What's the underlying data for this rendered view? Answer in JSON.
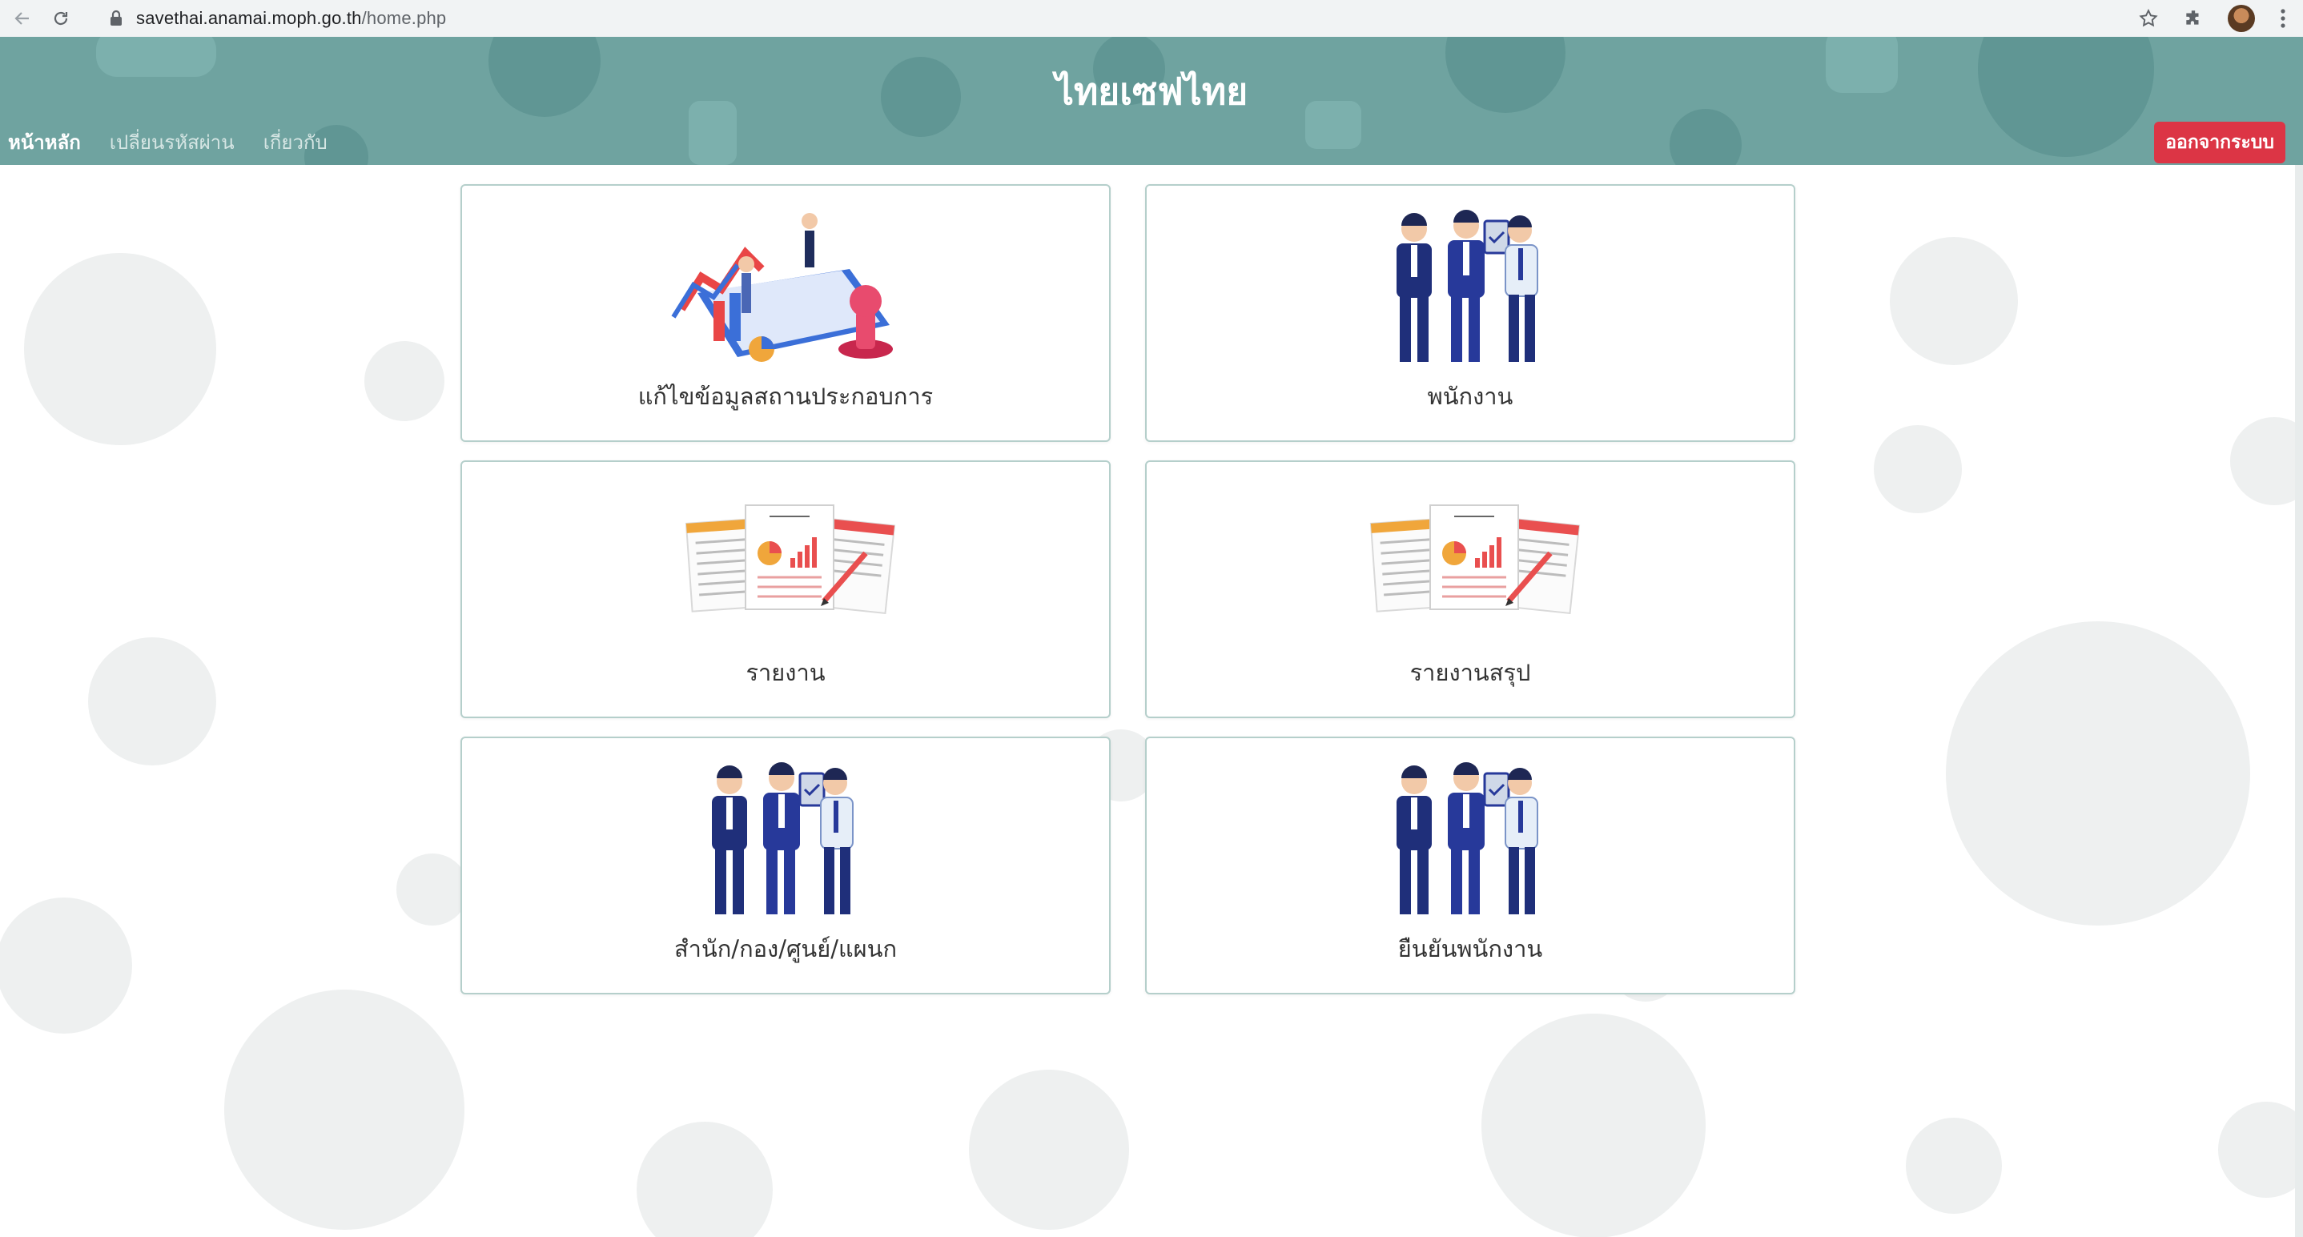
{
  "browser": {
    "url_host": "savethai.anamai.moph.go.th",
    "url_path": "/home.php",
    "icons": [
      "back-arrow-icon",
      "reload-icon",
      "lock-icon",
      "star-icon",
      "extensions-icon",
      "avatar",
      "kebab-menu-icon"
    ]
  },
  "header": {
    "title": "ไทยเซฟไทย",
    "nav": [
      {
        "label": "หน้าหลัก",
        "active": true
      },
      {
        "label": "เปลี่ยนรหัสผ่าน",
        "active": false
      },
      {
        "label": "เกี่ยวกับ",
        "active": false
      }
    ],
    "logout_label": "ออกจากระบบ",
    "colors": {
      "header_bg": "#6fa3a0",
      "logout_bg": "#dc3545"
    }
  },
  "menu_cards": [
    {
      "label": "แก้ไขข้อมูลสถานประกอบการ",
      "icon": "business-analytics-illustration"
    },
    {
      "label": "พนักงาน",
      "icon": "staff-group-illustration"
    },
    {
      "label": "รายงาน",
      "icon": "report-documents-illustration"
    },
    {
      "label": "รายงานสรุป",
      "icon": "report-documents-illustration"
    },
    {
      "label": "สำนัก/กอง/ศูนย์/แผนก",
      "icon": "staff-group-illustration"
    },
    {
      "label": "ยืนยันพนักงาน",
      "icon": "staff-group-illustration"
    }
  ]
}
